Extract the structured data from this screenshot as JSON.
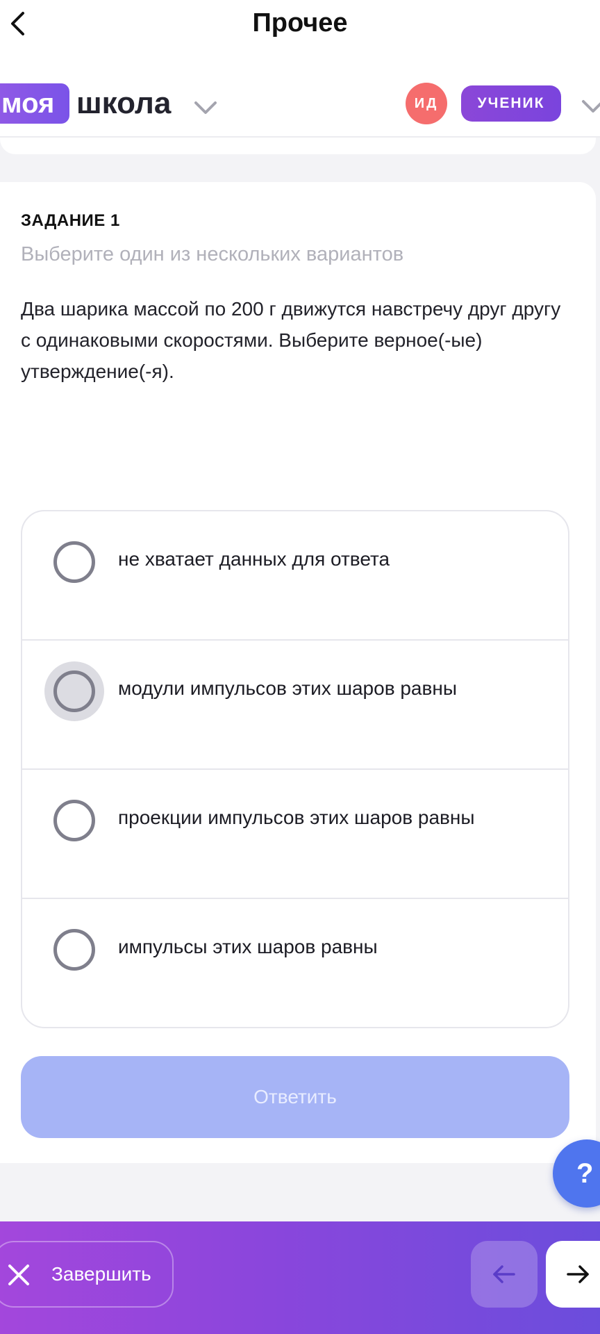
{
  "topbar": {
    "title": "Прочее"
  },
  "header": {
    "logo_part1": "моя",
    "logo_part2": "школа",
    "avatar_initials": "ИД",
    "role": "УЧЕНИК"
  },
  "task": {
    "label": "ЗАДАНИЕ 1",
    "hint": "Выберите один из нескольких вариантов",
    "question": "Два шарика массой по 200 г движутся навстречу друг другу с одинаковыми скоростями. Выберите верное(-ые) утверждение(-я).",
    "options": [
      {
        "text": "не хватает данных для ответа",
        "focused": false
      },
      {
        "text": "модули импульсов этих шаров равны",
        "focused": true
      },
      {
        "text": "проекции импульсов этих шаров равны",
        "focused": false
      },
      {
        "text": "импульсы этих шаров равны",
        "focused": false
      }
    ],
    "answer_label": "Ответить"
  },
  "help_label": "?",
  "bottombar": {
    "finish_label": "Завершить"
  },
  "colors": {
    "brand_purple": "#8f59e6",
    "avatar_red": "#f56d6d",
    "answer_disabled": "#a6b4f6",
    "help_blue": "#4f75ee"
  }
}
